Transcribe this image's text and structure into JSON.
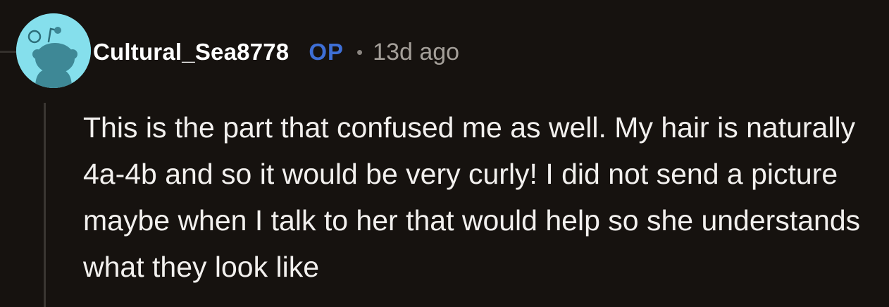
{
  "comment": {
    "author": "Cultural_Sea8778",
    "op_label": "OP",
    "separator": "•",
    "timestamp": "13d ago",
    "body": "This is the part that confused me as well. My hair is naturally 4a-4b and so it would be very curly! I did not send a picture maybe when I talk to her that would help so she understands what they look like"
  },
  "icons": {
    "avatar": "reddit-snoo-avatar-icon"
  },
  "colors": {
    "background": "#16120f",
    "avatar_background": "#85dfec",
    "op_badge": "#3e6fd6",
    "timestamp": "#a49f99",
    "thread_line": "#3a3632"
  }
}
